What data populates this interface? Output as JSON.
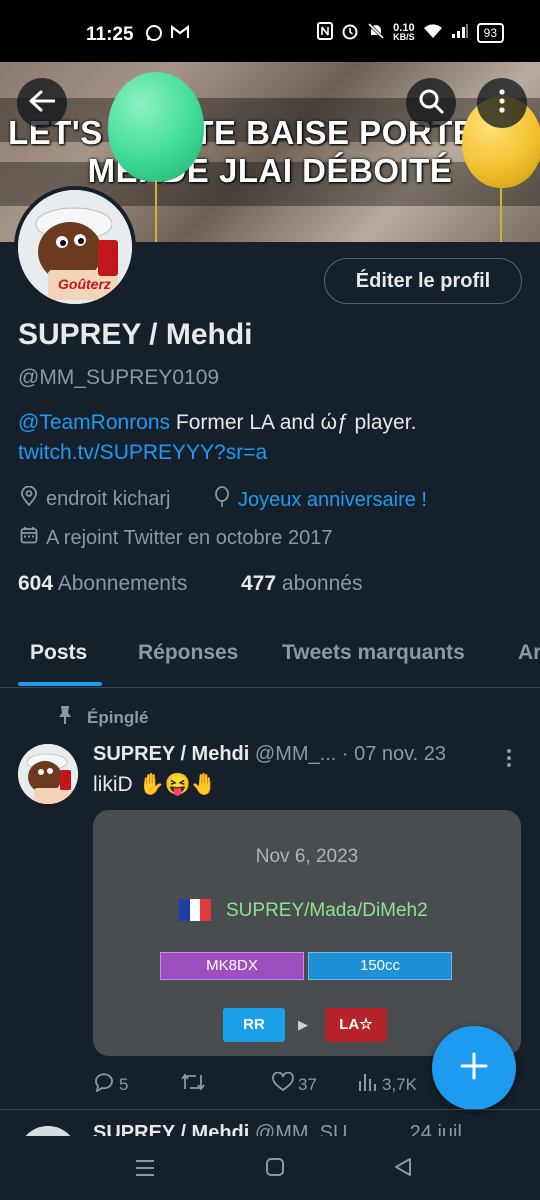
{
  "status_bar": {
    "time": "11:25",
    "net_speed_top": "0.10",
    "net_speed_bottom": "KB/S",
    "battery": "93"
  },
  "banner": {
    "text_line1": "LET'S GO JTE BAISE PORTE DE",
    "text_line2": "MERDE JLAI DÉBOITÉ",
    "balloon_colors": [
      "#3ddc97",
      "#f2c12e"
    ]
  },
  "avatar": {
    "label": "Goûterz"
  },
  "profile": {
    "edit_button": "Éditer le profil",
    "display_name": "SUPREY / Mehdi",
    "handle": "@MM_SUPREY0109",
    "bio_mention": "@TeamRonrons",
    "bio_text": " Former LA and ώƒ player.",
    "bio_link": "twitch.tv/SUPREYYY?sr=a",
    "location": "endroit kicharj",
    "birthday": "Joyeux anniversaire !",
    "joined": "A rejoint Twitter en octobre 2017",
    "following_count": "604",
    "following_label": "Abonnements",
    "followers_count": "477",
    "followers_label": "abonnés"
  },
  "tabs": [
    "Posts",
    "Réponses",
    "Tweets marquants",
    "Ar"
  ],
  "post": {
    "pinned_label": "Épinglé",
    "author": "SUPREY / Mehdi",
    "handle_truncated": "@MM_...",
    "date": "· 07 nov. 23",
    "text": "likiD ✋😝🤚",
    "card": {
      "date": "Nov 6, 2023",
      "team": "SUPREY/Mada/DiMeh2",
      "game": "MK8DX",
      "mode": "150cc",
      "from_tag": "RR",
      "to_tag": "LA☆"
    },
    "replies": "5",
    "likes": "37",
    "views": "3,7K"
  },
  "next_post": {
    "author": "SUPREY / Mehdi",
    "handle_truncated": "@MM_SU...",
    "date": "24 juil."
  },
  "accent_color": "#1d9bf0"
}
